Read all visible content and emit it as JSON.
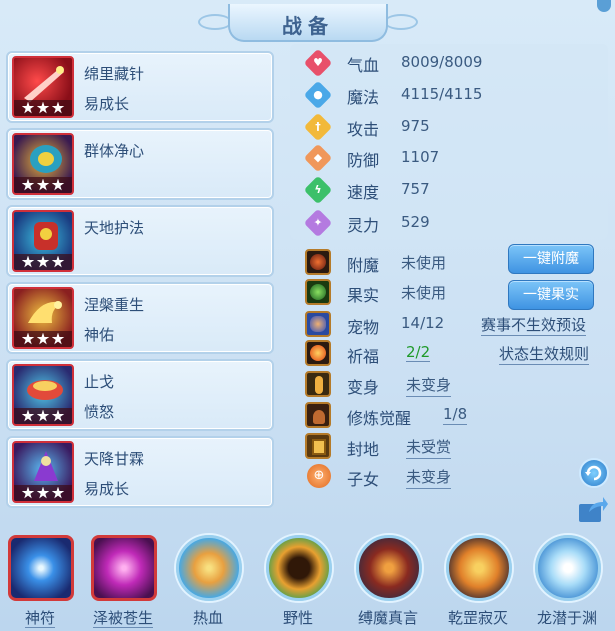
{
  "title": "战备",
  "items": [
    {
      "name": "绵里藏针",
      "sub": "易成长",
      "icon": "red-sword-icon"
    },
    {
      "name": "群体净心",
      "sub": "",
      "icon": "dragon-mask-icon"
    },
    {
      "name": "天地护法",
      "sub": "",
      "icon": "guardian-idol-icon"
    },
    {
      "name": "涅槃重生",
      "sub": "神佑",
      "icon": "phoenix-icon"
    },
    {
      "name": "止戈",
      "sub": "愤怒",
      "icon": "war-bowl-icon"
    },
    {
      "name": "天降甘霖",
      "sub": "易成长",
      "icon": "rain-spirit-icon"
    }
  ],
  "stats": [
    {
      "label": "气血",
      "value": "8009/8009",
      "color": "#e8506a",
      "icon": "heart-icon"
    },
    {
      "label": "魔法",
      "value": "4115/4115",
      "color": "#4aa8e8",
      "icon": "magic-icon"
    },
    {
      "label": "攻击",
      "value": "975",
      "color": "#f2b93a",
      "icon": "sword-icon"
    },
    {
      "label": "防御",
      "value": "1107",
      "color": "#f0975a",
      "icon": "shield-icon"
    },
    {
      "label": "速度",
      "value": "757",
      "color": "#3cc06a",
      "icon": "lightning-icon"
    },
    {
      "label": "灵力",
      "value": "529",
      "color": "#b47ae0",
      "icon": "spirit-icon"
    }
  ],
  "info": {
    "enchant": {
      "label": "附魔",
      "value": "未使用",
      "button": "一键附魔"
    },
    "fruit": {
      "label": "果实",
      "value": "未使用",
      "button": "一键果实"
    },
    "pet": {
      "label": "宠物",
      "value": "14/12",
      "link": "赛事不生效预设"
    },
    "bless": {
      "label": "祈福",
      "value": "2/2",
      "link": "状态生效规则"
    },
    "transform": {
      "label": "变身",
      "value": "未变身"
    },
    "awaken": {
      "label": "修炼觉醒",
      "value": "1/8"
    },
    "fief": {
      "label": "封地",
      "value": "未受赏"
    },
    "children": {
      "label": "子女",
      "value": "未变身"
    }
  },
  "skills": [
    {
      "label": "神符",
      "shape": "square"
    },
    {
      "label": "泽被苍生",
      "shape": "square"
    },
    {
      "label": "热血",
      "shape": "circle"
    },
    {
      "label": "野性",
      "shape": "circle"
    },
    {
      "label": "缚魔真言",
      "shape": "circle"
    },
    {
      "label": "乾罡寂灭",
      "shape": "circle"
    },
    {
      "label": "龙潜于渊",
      "shape": "circle"
    }
  ]
}
